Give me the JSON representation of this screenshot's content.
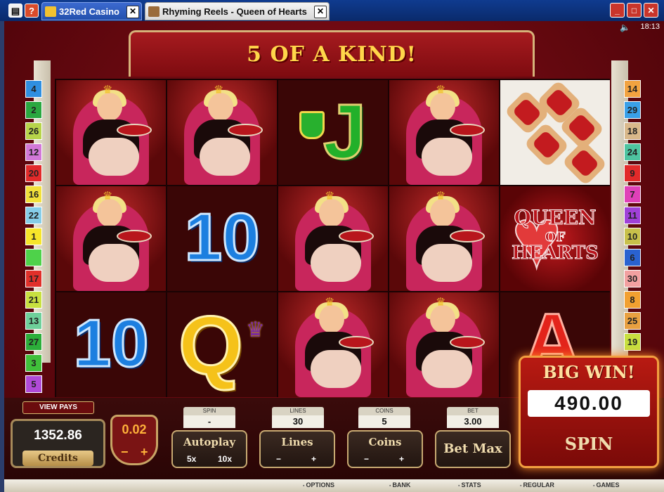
{
  "browser": {
    "tabs": [
      {
        "label": "32Red Casino"
      },
      {
        "label": "Rhyming Reels - Queen of Hearts"
      }
    ],
    "help_label": "?",
    "close_label": "✕"
  },
  "status": {
    "clock": "18:13"
  },
  "banner": {
    "text": "5 OF A KIND!"
  },
  "left_lines": [
    "4",
    "2",
    "26",
    "12",
    "20",
    "16",
    "22",
    "1",
    "",
    "17",
    "21",
    "13",
    "27",
    "3",
    "5"
  ],
  "right_lines": [
    "14",
    "29",
    "18",
    "24",
    "9",
    "7",
    "11",
    "10",
    "6",
    "30",
    "8",
    "25",
    "19"
  ],
  "reels": {
    "ten_label": "10",
    "j_label": "J",
    "q_label": "Q",
    "a_label": "A",
    "qoh_line1": "QUEEN",
    "qoh_line2": "OF",
    "qoh_line3": "HEARTS"
  },
  "controls": {
    "view_pays": "VIEW PAYS",
    "credits_value": "1352.86",
    "credits_label": "Credits",
    "coin_value": "0.02",
    "minus": "−",
    "plus": "+",
    "spin_stat_label": "SPIN",
    "spin_stat_value": "-",
    "lines_stat_label": "LINES",
    "lines_stat_value": "30",
    "coins_stat_label": "COINS",
    "coins_stat_value": "5",
    "bet_stat_label": "BET",
    "bet_stat_value": "3.00",
    "autoplay_label": "Autoplay",
    "autoplay_5x": "5x",
    "autoplay_10x": "10x",
    "lines_label": "Lines",
    "coins_label": "Coins",
    "betmax_label": "Bet Max"
  },
  "bigwin": {
    "title": "BIG WIN!",
    "value": "490.00",
    "spin_label": "SPIN"
  },
  "menu": [
    "OPTIONS",
    "BANK",
    "STATS",
    "REGULAR",
    "GAMES"
  ],
  "colors": {
    "accent_red": "#a61b1f",
    "gold": "#ffd64a",
    "frame_gold": "#c8aa72"
  }
}
